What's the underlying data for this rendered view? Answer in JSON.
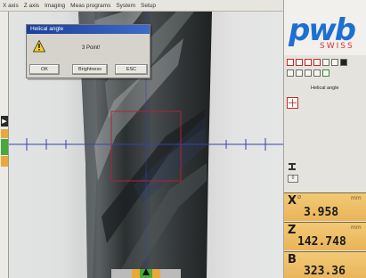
{
  "menu": [
    "X axis",
    "Z axis",
    "Imaging",
    "Meas programs",
    "System",
    "Setup"
  ],
  "dialog": {
    "title": "Helical angle",
    "message": "3 Point!",
    "buttons": [
      "OK",
      "Brightness",
      "ESC"
    ],
    "icon": "warning-icon"
  },
  "brand": {
    "logo": "pwb",
    "sub": "SWISS"
  },
  "panel": {
    "label": "Helical angle",
    "small_box": "0"
  },
  "axes": [
    {
      "letter": "X",
      "sub": "Ø",
      "unit": "mm",
      "value": "3.958"
    },
    {
      "letter": "Z",
      "sub": "",
      "unit": "mm",
      "value": "142.748"
    },
    {
      "letter": "B",
      "sub": "",
      "unit": "",
      "value": "323.36"
    }
  ],
  "colors": {
    "accent": "#1d6fd3",
    "axis_panel": "#ebb65c",
    "dialog_title": "#1a3f99",
    "crosshair": "#3344aa",
    "roi": "#b0213a"
  }
}
